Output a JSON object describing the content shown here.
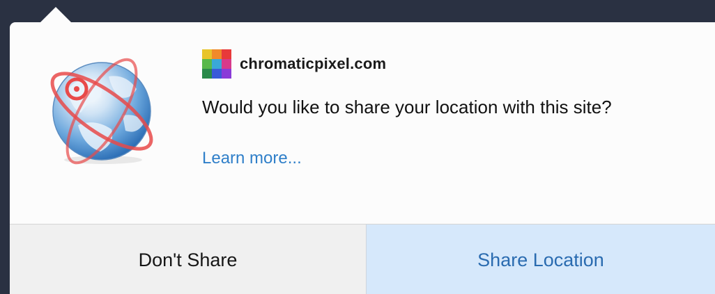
{
  "site": {
    "name": "chromaticpixel.com",
    "favicon_colors": [
      "#e8c42a",
      "#f08a2a",
      "#e83a3a",
      "#58b84a",
      "#3aa8d8",
      "#d83a8a",
      "#2a8a4a",
      "#3a5ad8",
      "#8a3ad8"
    ]
  },
  "prompt": {
    "question": "Would you like to share your location with this site?",
    "learn_more": "Learn more..."
  },
  "buttons": {
    "deny_label": "Don't Share",
    "allow_label": "Share Location"
  },
  "colors": {
    "backdrop": "#2a3142",
    "link": "#2f7fc9",
    "allow_bg": "#d6e8fb",
    "allow_text": "#2a6bb0",
    "orbit": "#e84a4a"
  },
  "icons": {
    "main": "globe-location-icon",
    "favicon": "site-favicon-icon"
  }
}
